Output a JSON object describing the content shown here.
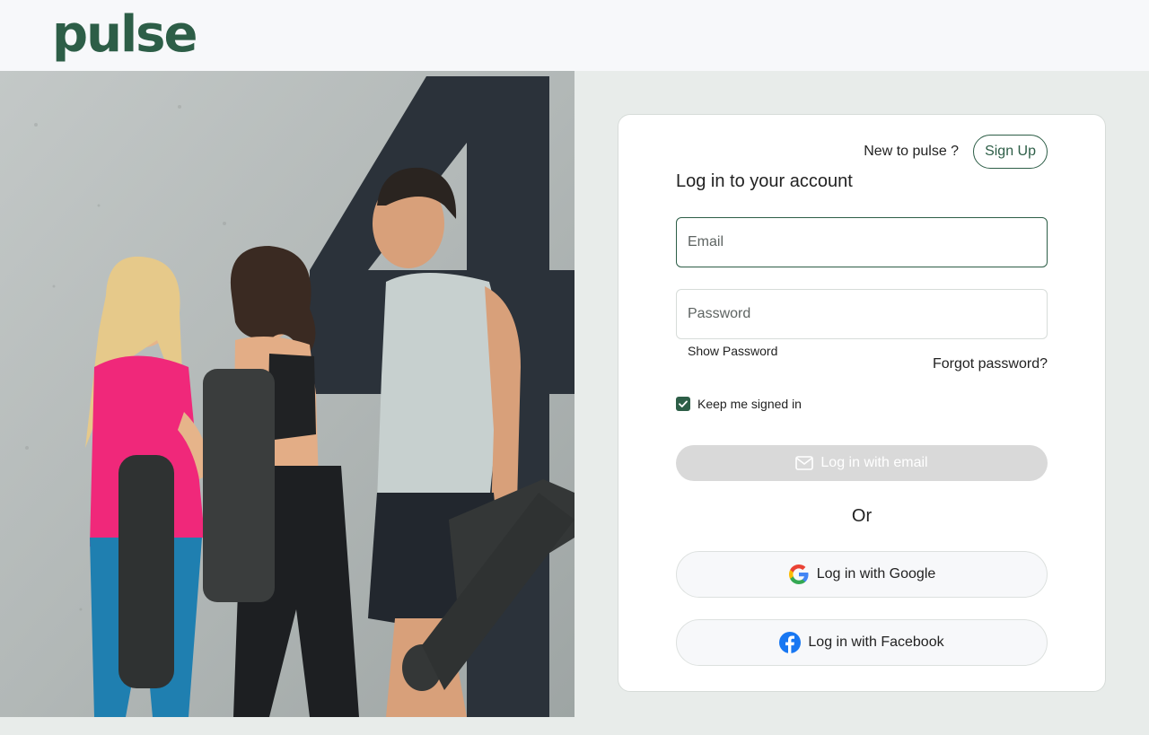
{
  "header": {
    "logo": "pulse"
  },
  "hero": {
    "wall_number": "4"
  },
  "login_card": {
    "signup_prompt": "New to pulse ?",
    "signup_label": "Sign Up",
    "title": "Log in to your account",
    "email_placeholder": "Email",
    "password_placeholder": "Password",
    "show_password_label": "Show Password",
    "forgot_password_label": "Forgot password?",
    "keep_signed_in_label": "Keep me signed in",
    "keep_signed_in_checked": true,
    "email_login_label": "Log in with email",
    "or_label": "Or",
    "google_login_label": "Log in with Google",
    "facebook_login_label": "Log in with Facebook"
  },
  "colors": {
    "brand": "#2d5e47",
    "page_background": "#e8ecea",
    "header_background": "#f7f8fa",
    "disabled_button": "#d9d9d9",
    "facebook_blue": "#1877f2"
  },
  "icons": {
    "email_button": "envelope-icon",
    "google_button": "google-g-icon",
    "facebook_button": "facebook-f-icon",
    "checkbox": "check-icon"
  }
}
